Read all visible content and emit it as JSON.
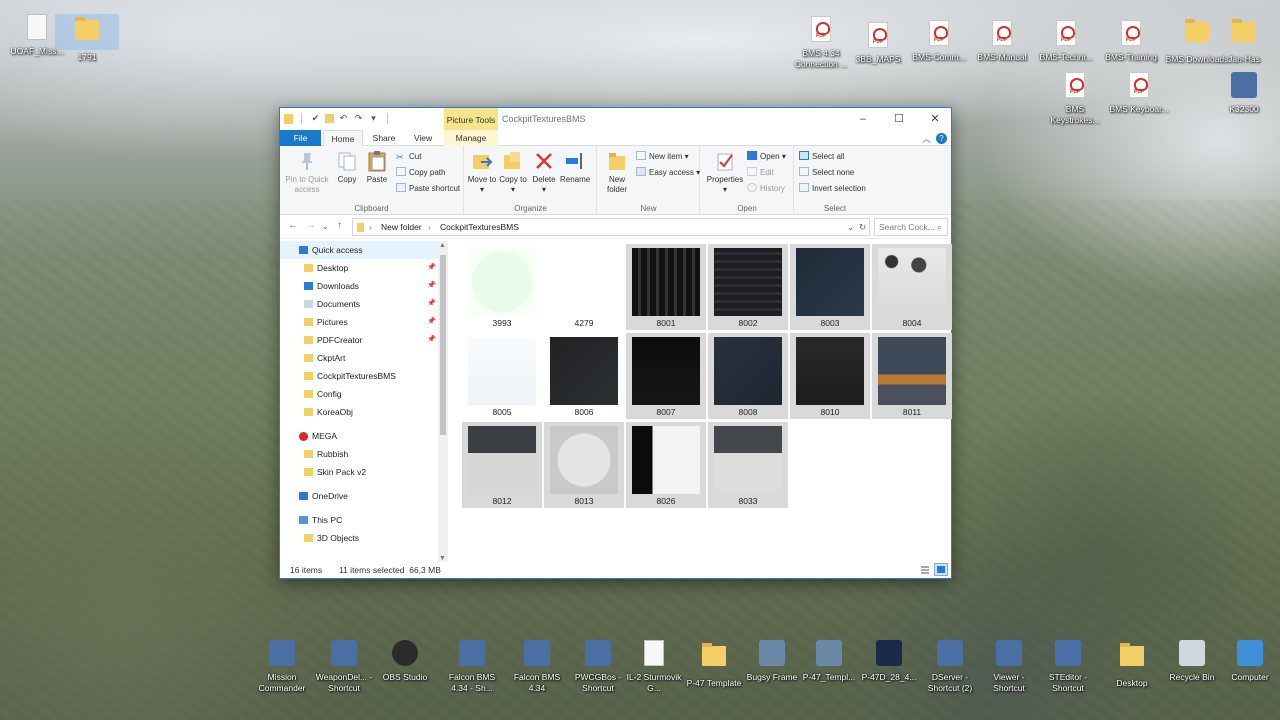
{
  "desktop": {
    "top_left_icons": [
      {
        "label": "UOAF_Miss...",
        "icon": "document-icon"
      },
      {
        "label": "1791",
        "icon": "folder-icon"
      }
    ],
    "top_right_icons": [
      {
        "label": "BMS 4.34 Connection ...",
        "icon": "pdf-icon"
      },
      {
        "label": "3BB_MAPS",
        "icon": "pdf-icon"
      },
      {
        "label": "BMS-Comm...",
        "icon": "pdf-icon"
      },
      {
        "label": "BMS-Manual",
        "icon": "pdf-icon"
      },
      {
        "label": "BMS-Techni...",
        "icon": "pdf-icon"
      },
      {
        "label": "BMS-Training",
        "icon": "pdf-icon"
      },
      {
        "label": "BMS Downloads",
        "icon": "folder-icon"
      },
      {
        "label": "Jan-Has",
        "icon": "folder-icon"
      },
      {
        "label": "BMS Keystrokes...",
        "icon": "pdf-icon"
      },
      {
        "label": "BMS Keyboar...",
        "icon": "pdf-icon"
      },
      {
        "label": "K32300",
        "icon": "app-icon"
      }
    ],
    "bottom_icons": [
      {
        "label": "Mission Commander",
        "icon": "app-icon"
      },
      {
        "label": "WeaponDel... - Shortcut",
        "icon": "app-icon"
      },
      {
        "label": "OBS Studio",
        "icon": "obs-icon"
      },
      {
        "label": "Falcon BMS 4.34 - Sh...",
        "icon": "app-icon"
      },
      {
        "label": "Falcon BMS 4.34",
        "icon": "app-icon"
      },
      {
        "label": "PWCGBos - Shortcut",
        "icon": "app-icon"
      },
      {
        "label": "IL-2 Sturmovik G...",
        "icon": "document-icon"
      },
      {
        "label": "P-47 Template",
        "icon": "folder-icon"
      },
      {
        "label": "Bugsy Frame",
        "icon": "image-icon"
      },
      {
        "label": "P-47_Templ...",
        "icon": "image-icon"
      },
      {
        "label": "P-47D_28_4...",
        "icon": "photoshop-icon"
      },
      {
        "label": "DServer - Shortcut (2)",
        "icon": "app-icon"
      },
      {
        "label": "Viewer - Shortcut",
        "icon": "app-icon"
      },
      {
        "label": "STEditor - Shortcut",
        "icon": "app-icon"
      },
      {
        "label": "Desktop",
        "icon": "folder-icon"
      },
      {
        "label": "Recycle Bin",
        "icon": "recycle-bin-icon"
      },
      {
        "label": "Computer",
        "icon": "computer-icon"
      }
    ]
  },
  "window": {
    "title": "CockpitTexturesBMS",
    "context_tab": "Picture Tools",
    "tabs": {
      "file": "File",
      "home": "Home",
      "share": "Share",
      "view": "View",
      "manage": "Manage"
    },
    "help": "?",
    "ribbon": {
      "clipboard": {
        "name": "Clipboard",
        "pin": "Pin to Quick access",
        "copy": "Copy",
        "paste": "Paste",
        "cut": "Cut",
        "copy_path": "Copy path",
        "paste_shortcut": "Paste shortcut"
      },
      "organize": {
        "name": "Organize",
        "move_to": "Move to",
        "copy_to": "Copy to",
        "delete": "Delete",
        "rename": "Rename"
      },
      "new": {
        "name": "New",
        "new_folder": "New folder",
        "new_item": "New item",
        "easy_access": "Easy access"
      },
      "open": {
        "name": "Open",
        "properties": "Properties",
        "open": "Open",
        "edit": "Edit",
        "history": "History"
      },
      "select": {
        "name": "Select",
        "select_all": "Select all",
        "select_none": "Select none",
        "invert": "Invert selection"
      }
    },
    "address": {
      "crumbs": [
        "New folder",
        "CockpitTexturesBMS"
      ],
      "search_placeholder": "Search Cock..."
    },
    "nav": [
      {
        "label": "Quick access",
        "icon": "star-icon",
        "indent": 0,
        "selected": true,
        "pinned": false
      },
      {
        "label": "Desktop",
        "icon": "folder-icon",
        "indent": 1,
        "selected": false,
        "pinned": true
      },
      {
        "label": "Downloads",
        "icon": "download-icon",
        "indent": 1,
        "selected": false,
        "pinned": true
      },
      {
        "label": "Documents",
        "icon": "document-icon",
        "indent": 1,
        "selected": false,
        "pinned": true
      },
      {
        "label": "Pictures",
        "icon": "folder-icon",
        "indent": 1,
        "selected": false,
        "pinned": true
      },
      {
        "label": "PDFCreator",
        "icon": "folder-icon",
        "indent": 1,
        "selected": false,
        "pinned": true
      },
      {
        "label": "CkptArt",
        "icon": "folder-icon",
        "indent": 1,
        "selected": false,
        "pinned": false
      },
      {
        "label": "CockpitTexturesBMS",
        "icon": "folder-icon",
        "indent": 1,
        "selected": false,
        "pinned": false
      },
      {
        "label": "Config",
        "icon": "folder-icon",
        "indent": 1,
        "selected": false,
        "pinned": false
      },
      {
        "label": "KoreaObj",
        "icon": "folder-icon",
        "indent": 1,
        "selected": false,
        "pinned": false
      },
      {
        "label": "MEGA",
        "icon": "mega-icon",
        "indent": 0,
        "selected": false,
        "pinned": false
      },
      {
        "label": "Rubbish",
        "icon": "folder-icon",
        "indent": 1,
        "selected": false,
        "pinned": false
      },
      {
        "label": "Skin Pack v2",
        "icon": "folder-icon",
        "indent": 1,
        "selected": false,
        "pinned": false
      },
      {
        "label": "OneDrive",
        "icon": "cloud-icon",
        "indent": 0,
        "selected": false,
        "pinned": false
      },
      {
        "label": "This PC",
        "icon": "computer-icon",
        "indent": 0,
        "selected": false,
        "pinned": false
      },
      {
        "label": "3D Objects",
        "icon": "folder-icon",
        "indent": 1,
        "selected": false,
        "pinned": false
      }
    ],
    "files": [
      {
        "name": "3993",
        "selected": false,
        "thumb": "light-green"
      },
      {
        "name": "4279",
        "selected": false,
        "thumb": "white-sketch"
      },
      {
        "name": "8001",
        "selected": true,
        "thumb": "black-panels"
      },
      {
        "name": "8002",
        "selected": true,
        "thumb": "dark-panels"
      },
      {
        "name": "8003",
        "selected": true,
        "thumb": "dark-blue"
      },
      {
        "name": "8004",
        "selected": true,
        "thumb": "gauges"
      },
      {
        "name": "8005",
        "selected": false,
        "thumb": "white-sketch-2"
      },
      {
        "name": "8006",
        "selected": false,
        "thumb": "dark-grey"
      },
      {
        "name": "8007",
        "selected": true,
        "thumb": "black"
      },
      {
        "name": "8008",
        "selected": true,
        "thumb": "dark-blue-2"
      },
      {
        "name": "8010",
        "selected": true,
        "thumb": "charcoal"
      },
      {
        "name": "8011",
        "selected": true,
        "thumb": "blue-orange"
      },
      {
        "name": "8012",
        "selected": true,
        "thumb": "grey-panel"
      },
      {
        "name": "8013",
        "selected": true,
        "thumb": "grey-mask"
      },
      {
        "name": "8026",
        "selected": true,
        "thumb": "white-black"
      },
      {
        "name": "8033",
        "selected": true,
        "thumb": "grey-panel-2"
      }
    ],
    "status": {
      "count": "16 items",
      "selection": "11 items selected  66,3 MB"
    }
  }
}
